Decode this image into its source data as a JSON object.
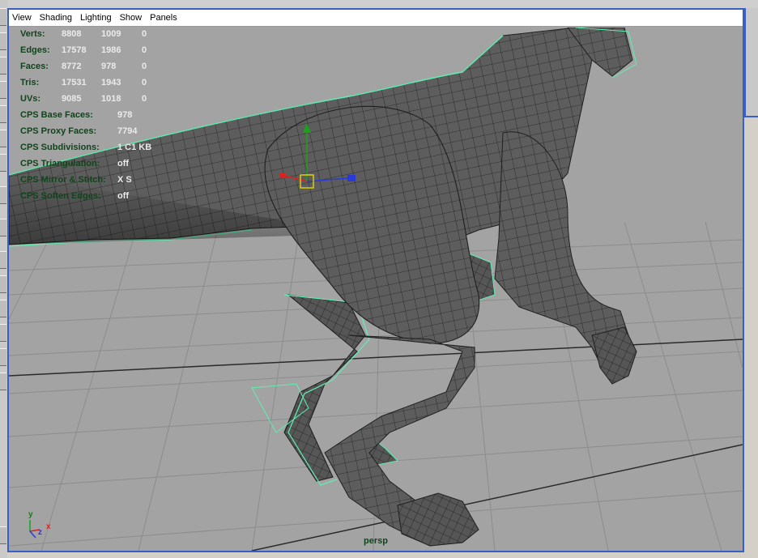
{
  "panel_menu": {
    "items": [
      "View",
      "Shading",
      "Lighting",
      "Show",
      "Panels"
    ]
  },
  "hud": {
    "poly_stats": [
      {
        "label": "Verts:",
        "values": [
          "8808",
          "1009",
          "0"
        ]
      },
      {
        "label": "Edges:",
        "values": [
          "17578",
          "1986",
          "0"
        ]
      },
      {
        "label": "Faces:",
        "values": [
          "8772",
          "978",
          "0"
        ]
      },
      {
        "label": "Tris:",
        "values": [
          "17531",
          "1943",
          "0"
        ]
      },
      {
        "label": "UVs:",
        "values": [
          "9085",
          "1018",
          "0"
        ]
      }
    ],
    "cps": [
      {
        "label": "CPS Base Faces:",
        "value": "978"
      },
      {
        "label": "CPS Proxy Faces:",
        "value": "7794"
      },
      {
        "label": "CPS Subdivisions:",
        "value": "1 C1 KB"
      },
      {
        "label": "CPS Triangulation:",
        "value": "off"
      },
      {
        "label": "CPS Mirror & Stitch:",
        "value": "X S"
      },
      {
        "label": "CPS Soften Edges:",
        "value": "off"
      }
    ]
  },
  "camera": {
    "name": "persp"
  },
  "axes": {
    "x": "x",
    "y": "y",
    "z": "z"
  },
  "colors": {
    "viewport_bg": "#a3a3a3",
    "grid_line": "#8c8c8c",
    "grid_axis": "#2a2a2a",
    "hud_label": "#11441b",
    "hud_value": "#eaeaea",
    "mesh_fill": "#5e5e5e",
    "wire": "#1f1f1f",
    "proxy_cage": "#5ef0b0",
    "active_border": "#3a5fc4"
  }
}
